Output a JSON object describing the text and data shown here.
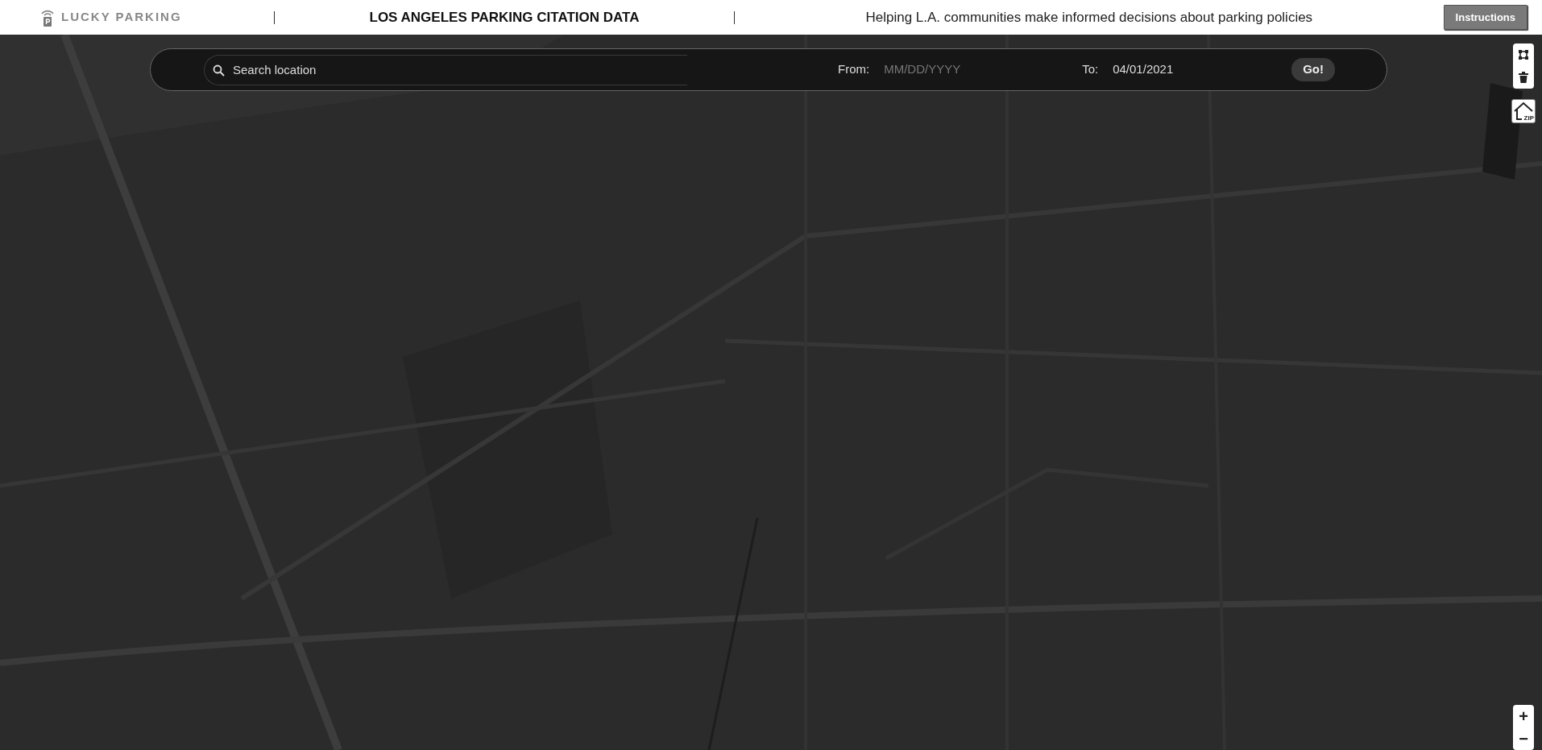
{
  "header": {
    "logo_text": "LUCKY PARKING",
    "title": "LOS ANGELES PARKING CITATION DATA",
    "tagline": "Helping L.A. communities make informed decisions about parking policies",
    "instructions_button": "Instructions"
  },
  "search_bar": {
    "search": {
      "placeholder": "Search location"
    },
    "from": {
      "label": "From:",
      "placeholder": "MM/DD/YYYY"
    },
    "to": {
      "label": "To:",
      "value": "04/01/2021"
    },
    "go_button": "Go!"
  },
  "map": {
    "kind": "picture",
    "zip_label": "ZIP",
    "zoom_in": "+",
    "zoom_out": "−"
  }
}
